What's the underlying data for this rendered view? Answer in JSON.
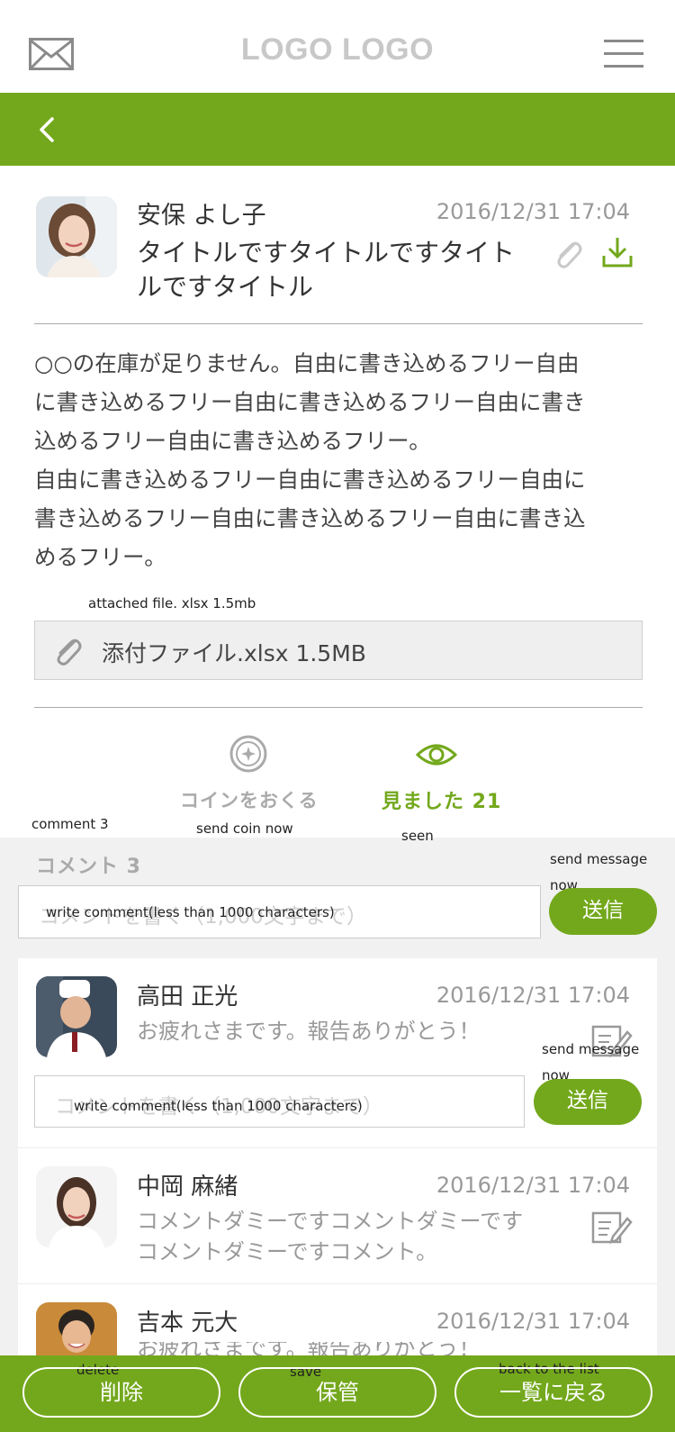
{
  "header": {
    "logo": "LOGO LOGO",
    "icons": {
      "left": "mail-icon",
      "right": "hamburger-menu-icon",
      "back": "chevron-left-icon"
    }
  },
  "colors": {
    "accent": "#73a81c",
    "logo_gray": "#c8c8c8",
    "comment_bg": "#f1f1f1"
  },
  "post": {
    "sender": "安保 よし子",
    "date": "2016/12/31 17:04",
    "title": "タイトルですタイトルですタイト\nルですタイトル",
    "body": "○○の在庫が足りません。自由に書き込めるフリー自由\nに書き込めるフリー自由に書き込めるフリー自由に書き\n込めるフリー自由に書き込めるフリー。\n自由に書き込めるフリー自由に書き込めるフリー自由に\n書き込めるフリー自由に書き込めるフリー自由に書き込\nめるフリー。",
    "attachment_note": "attached file. xlsx 1.5mb",
    "attachment": "添付ファイル.xlsx  1.5MB"
  },
  "actions": {
    "coin_label": "コインをおくる",
    "coin_note": "send coin now",
    "seen_label": "見ました 21",
    "seen_note": "seen"
  },
  "comments": {
    "header": "コメント 3",
    "header_note": "comment 3",
    "input_placeholder": "コメントを書く（1,000文字まで）",
    "input_note": "write comment(less than 1000 characters)",
    "send_label": "送信",
    "send_note_line1": "send message",
    "send_note_line2": "now",
    "items": [
      {
        "name": "高田 正光",
        "date": "2016/12/31 17:04",
        "text": "お疲れさまです。報告ありがとう！"
      },
      {
        "name": "中岡 麻緒",
        "date": "2016/12/31 17:04",
        "text": "コメントダミーですコメントダミーです\nコメントダミーですコメント。"
      },
      {
        "name": "吉本 元大",
        "date": "2016/12/31 17:04",
        "text": "お疲れさまです。報告ありがとう！"
      }
    ]
  },
  "footer": {
    "delete_label": "削除",
    "delete_note": "delete",
    "save_label": "保管",
    "save_note": "save",
    "back_label": "一覧に戻る",
    "back_note": "back to the list"
  }
}
